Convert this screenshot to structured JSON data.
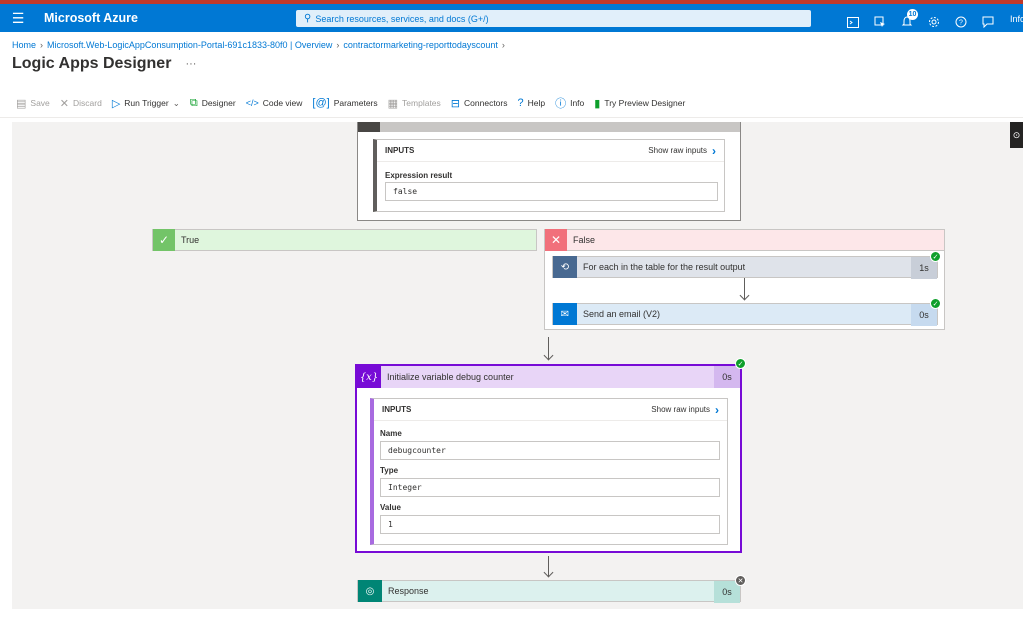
{
  "top": {
    "brand": "Microsoft Azure",
    "search_placeholder": "Search resources, services, and docs (G+/)",
    "notification_count": "10",
    "user_text": "Info"
  },
  "breadcrumb": {
    "home": "Home",
    "resource": "Microsoft.Web-LogicAppConsumption-Portal-691c1833-80f0 | Overview",
    "current": "contractormarketing-reporttodayscount"
  },
  "page": {
    "title": "Logic Apps Designer",
    "more": "···"
  },
  "toolbar": {
    "save": "Save",
    "discard": "Discard",
    "run_trigger": "Run Trigger",
    "designer": "Designer",
    "code_view": "Code view",
    "parameters": "Parameters",
    "templates": "Templates",
    "connectors": "Connectors",
    "help": "Help",
    "info": "Info",
    "try_preview": "Try Preview Designer"
  },
  "condition_card": {
    "inputs_title": "INPUTS",
    "show_raw": "Show raw inputs",
    "field_label": "Expression result",
    "field_value": "false"
  },
  "branches": {
    "true_label": "True",
    "false_label": "False"
  },
  "for_each": {
    "label": "For each in the table for the result output",
    "duration": "1s"
  },
  "send_email": {
    "label": "Send an email (V2)",
    "duration": "0s"
  },
  "init_variable": {
    "label": "Initialize variable debug counter",
    "duration": "0s",
    "icon_text": "{x}",
    "inputs_title": "INPUTS",
    "show_raw": "Show raw inputs",
    "name_label": "Name",
    "name_value": "debugcounter",
    "type_label": "Type",
    "type_value": "Integer",
    "value_label": "Value",
    "value_value": "1"
  },
  "response": {
    "label": "Response",
    "duration": "0s"
  },
  "colors": {
    "azure_blue": "#0078d4",
    "true_green": "#dff6dd",
    "false_red": "#fde7e9",
    "variable_purple": "#770bd6",
    "response_teal": "#008575",
    "success": "#0e9f2b"
  }
}
